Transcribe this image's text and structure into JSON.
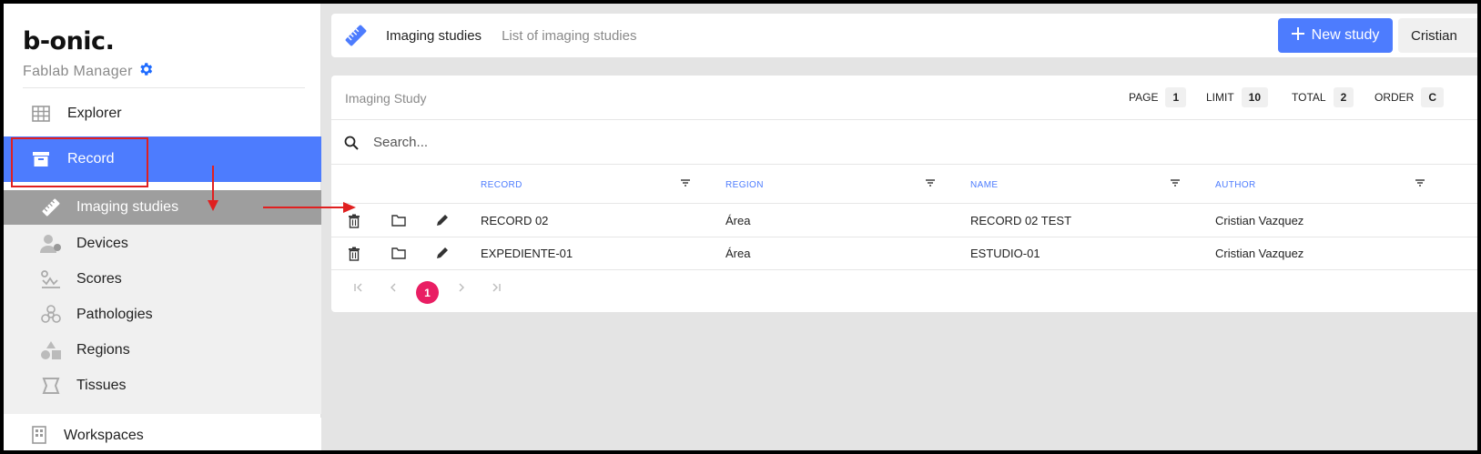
{
  "sidebar": {
    "logo": "b-onic",
    "logo_dot": ".",
    "subtitle": "Fablab Manager",
    "items": [
      {
        "label": "Explorer",
        "icon": "grid-icon"
      },
      {
        "label": "Record",
        "icon": "archive-icon"
      }
    ],
    "sub_items": [
      {
        "label": "Imaging studies",
        "icon": "ruler-icon"
      },
      {
        "label": "Devices",
        "icon": "user-device-icon"
      },
      {
        "label": "Scores",
        "icon": "score-icon"
      },
      {
        "label": "Pathologies",
        "icon": "biohazard-icon"
      },
      {
        "label": "Regions",
        "icon": "shapes-icon"
      },
      {
        "label": "Tissues",
        "icon": "tissue-icon"
      }
    ],
    "bottom_item": {
      "label": "Workspaces",
      "icon": "building-icon"
    }
  },
  "header": {
    "title": "Imaging studies",
    "subtitle": "List of imaging studies",
    "new_button": "New study",
    "user_button": "Cristian"
  },
  "card": {
    "title": "Imaging Study",
    "meta": {
      "page_label": "PAGE",
      "page_value": "1",
      "limit_label": "LIMIT",
      "limit_value": "10",
      "total_label": "TOTAL",
      "total_value": "2",
      "order_label": "ORDER",
      "order_value": "C"
    },
    "search_placeholder": "Search...",
    "columns": [
      "RECORD",
      "REGION",
      "NAME",
      "AUTHOR"
    ],
    "rows": [
      {
        "record": "RECORD 02",
        "region": "Área",
        "name": "RECORD 02 TEST",
        "author": "Cristian Vazquez"
      },
      {
        "record": "EXPEDIENTE-01",
        "region": "Área",
        "name": "ESTUDIO-01",
        "author": "Cristian Vazquez"
      }
    ],
    "pagination": {
      "current": "1"
    }
  },
  "colors": {
    "accent": "#4d7cfe",
    "pager_active": "#e91e63",
    "annotation": "#e02020",
    "submenu_active": "#9e9e9e"
  }
}
